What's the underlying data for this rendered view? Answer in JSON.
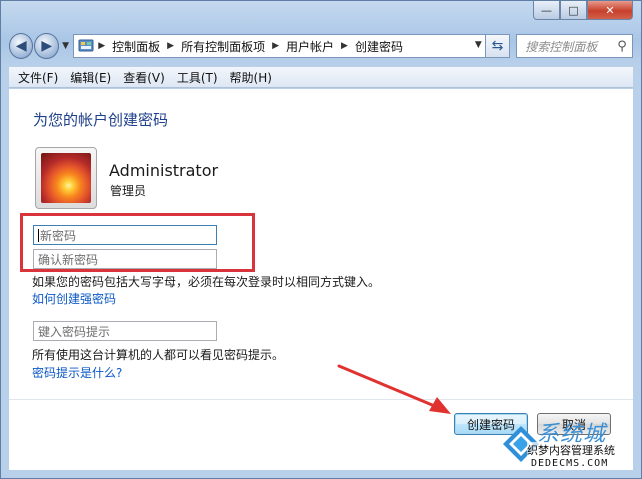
{
  "window": {
    "caption": {
      "minimize": "—",
      "maximize": "□",
      "close": "✕"
    }
  },
  "nav": {
    "back": "◀",
    "forward": "▶",
    "breadcrumbs": [
      "控制面板",
      "所有控制面板项",
      "用户帐户",
      "创建密码"
    ],
    "search_placeholder": "搜索控制面板",
    "icons": [
      "back-arrow-icon",
      "forward-arrow-icon",
      "control-panel-icon",
      "refresh-icon",
      "search-icon"
    ]
  },
  "menu": [
    "文件(F)",
    "编辑(E)",
    "查看(V)",
    "工具(T)",
    "帮助(H)"
  ],
  "main": {
    "title": "为您的帐户创建密码",
    "user_name": "Administrator",
    "user_role": "管理员",
    "new_password_placeholder": "新密码",
    "confirm_password_placeholder": "确认新密码",
    "caps_note": "如果您的密码包括大写字母，必须在每次登录时以相同方式键入。",
    "strong_link": "如何创建强密码",
    "hint_placeholder": "键入密码提示",
    "hint_note": "所有使用这台计算机的人都可以看见密码提示。",
    "hint_link": "密码提示是什么?",
    "create_button": "创建密码",
    "cancel_button": "取消"
  },
  "watermark": {
    "text1": "系统城",
    "text2": "织梦内容管理系统",
    "text3": "DEDECMS.COM"
  },
  "colors": {
    "title": "#1e3f8a",
    "link": "#0b58c6",
    "highlight": "#d9343c",
    "arrow": "#e0322f"
  }
}
